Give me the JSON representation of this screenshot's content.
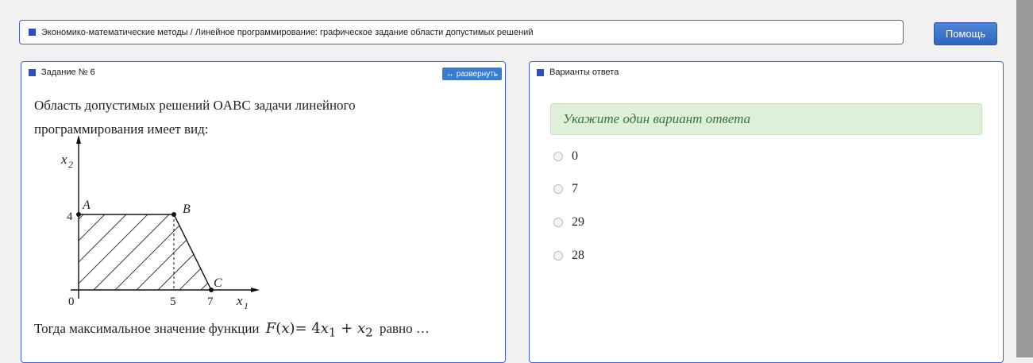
{
  "breadcrumb": "Экономико-математические методы / Линейное программирование: графическое задание области допустимых решений",
  "help_button": "Помощь",
  "task_panel": {
    "title": "Задание № 6",
    "expand_button": "развернуть",
    "text_line1": "Область допустимых решений OABC задачи линейного",
    "text_line2": "программирования имеет вид:",
    "question_before": "Тогда максимальное значение функции",
    "question_after": "равно …",
    "formula": {
      "F": "F",
      "x": "x",
      "eq": "= 4",
      "x1": "x",
      "sub1": "1",
      "plus": " + ",
      "x2": "x",
      "sub2": "2"
    },
    "graph": {
      "y_axis_label": "x",
      "y_axis_sub": "2",
      "x_axis_label": "x",
      "x_axis_sub": "1",
      "origin": "0",
      "y_tick": "4",
      "x_tick_5": "5",
      "x_tick_7": "7",
      "point_A": "A",
      "point_B": "B",
      "point_C": "C"
    }
  },
  "answers_panel": {
    "title": "Варианты ответа",
    "hint": "Укажите один вариант ответа",
    "options": [
      "0",
      "7",
      "29",
      "28"
    ]
  }
}
